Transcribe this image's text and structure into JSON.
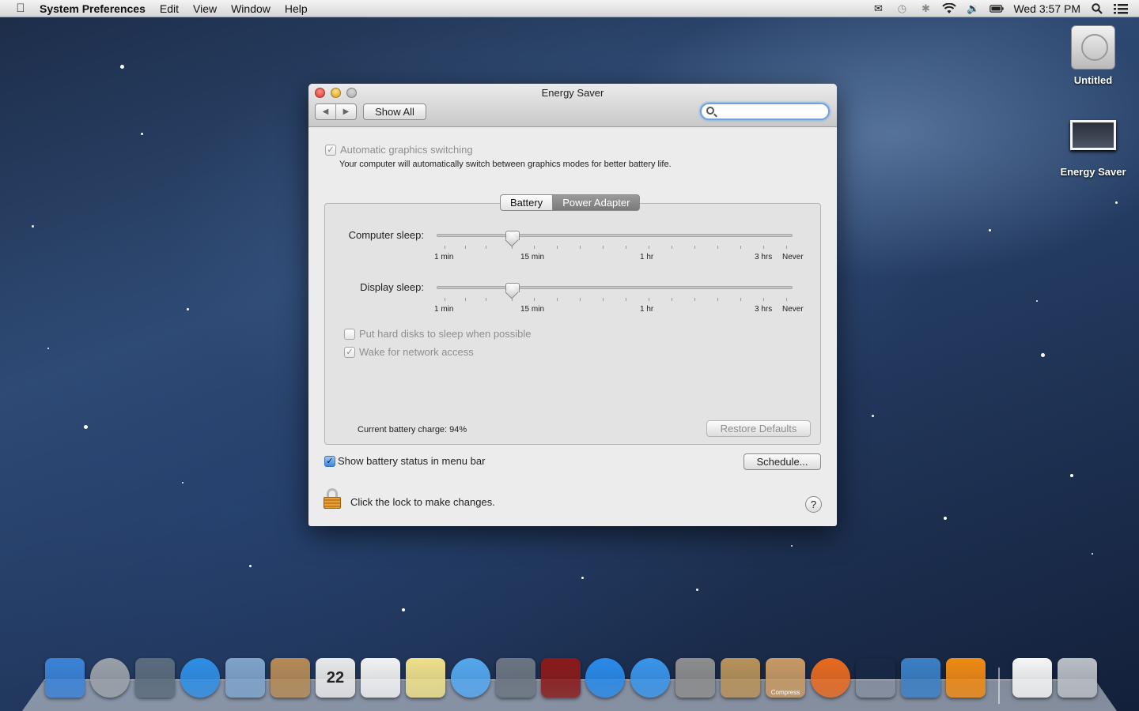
{
  "menubar": {
    "app_name": "System Preferences",
    "menus": [
      "Edit",
      "View",
      "Window",
      "Help"
    ],
    "clock": "Wed 3:57 PM",
    "status_icons": [
      "mail-alert-icon",
      "time-machine-icon",
      "bluetooth-icon",
      "wifi-icon",
      "volume-icon",
      "battery-icon",
      "spotlight-icon",
      "notification-center-icon"
    ]
  },
  "desktop": {
    "icons": [
      {
        "label": "Untitled",
        "icon": "hard-drive-icon"
      },
      {
        "label": "Energy Saver",
        "icon": "screenshot-icon"
      }
    ]
  },
  "window": {
    "title": "Energy Saver",
    "show_all": "Show All",
    "search_placeholder": "",
    "auto_graphics": {
      "label": "Automatic graphics switching",
      "checked": true,
      "description": "Your computer will automatically switch between graphics modes for better battery life."
    },
    "tabs": [
      {
        "label": "Battery",
        "selected": false
      },
      {
        "label": "Power Adapter",
        "selected": true
      }
    ],
    "computer_sleep": {
      "label": "Computer sleep:",
      "value": "15 min",
      "ticks": [
        "1 min",
        "15 min",
        "1 hr",
        "3 hrs",
        "Never"
      ]
    },
    "display_sleep": {
      "label": "Display sleep:",
      "value": "15 min",
      "ticks": [
        "1 min",
        "15 min",
        "1 hr",
        "3 hrs",
        "Never"
      ]
    },
    "hard_disks": {
      "label": "Put hard disks to sleep when possible",
      "checked": false
    },
    "wake_network": {
      "label": "Wake for network access",
      "checked": true
    },
    "battery_charge": "Current battery charge: 94%",
    "restore_defaults": "Restore Defaults",
    "show_battery": {
      "label": "Show battery status in menu bar",
      "checked": true
    },
    "schedule": "Schedule...",
    "lock_text": "Click the lock to make changes.",
    "help": "?"
  },
  "dock": {
    "items": [
      {
        "name": "finder",
        "color": "#3b82d6"
      },
      {
        "name": "launchpad",
        "color": "#9aa0a8"
      },
      {
        "name": "mission-control",
        "color": "#5a6b7c"
      },
      {
        "name": "safari",
        "color": "#2f8ee3"
      },
      {
        "name": "mail",
        "color": "#7fa3c9"
      },
      {
        "name": "contacts",
        "color": "#b58a55"
      },
      {
        "name": "calendar",
        "color": "#e9e9e9",
        "text": "22"
      },
      {
        "name": "reminders",
        "color": "#f2f2f2"
      },
      {
        "name": "notes",
        "color": "#f0e08a"
      },
      {
        "name": "messages",
        "color": "#55a7ee"
      },
      {
        "name": "facetime",
        "color": "#6b7480"
      },
      {
        "name": "photo-booth",
        "color": "#8b1a1a"
      },
      {
        "name": "itunes",
        "color": "#2a8ae8"
      },
      {
        "name": "app-store",
        "color": "#3a95ea"
      },
      {
        "name": "system-preferences",
        "color": "#8d8d8d"
      },
      {
        "name": "archive-utility",
        "color": "#b8925a"
      },
      {
        "name": "compress",
        "color": "#c79a63",
        "text": "Compress"
      },
      {
        "name": "firefox",
        "color": "#e86a1f"
      },
      {
        "name": "preview",
        "color": "#d33"
      },
      {
        "name": "finder-alt",
        "color": "#3b7fc4"
      },
      {
        "name": "vlc",
        "color": "#f08a12"
      },
      {
        "name": "document",
        "color": "#f6f6f6"
      },
      {
        "name": "trash",
        "color": "#b9bec4"
      }
    ]
  }
}
